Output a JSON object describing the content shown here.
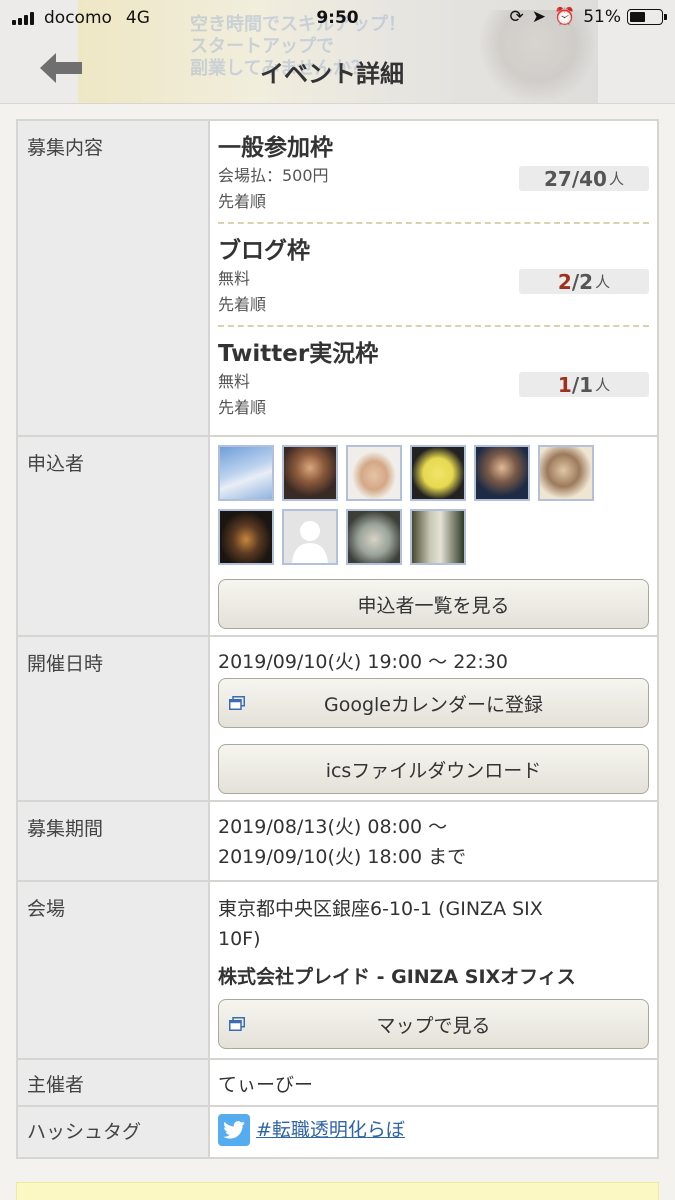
{
  "status_bar": {
    "carrier": "docomo",
    "network": "4G",
    "time": "9:50",
    "battery": "51%",
    "battery_level": 0.51
  },
  "banner": {
    "line1": "空き時間でスキルアップ！",
    "line2": "スタートアップで",
    "line3": "副業してみませんか？"
  },
  "header": {
    "title": "イベント詳細",
    "back_icon": "back-arrow-icon"
  },
  "recruitment": {
    "label": "募集内容",
    "slots": [
      {
        "name": "一般参加枠",
        "fee": "会場払：500円",
        "order": "先着順",
        "current": "27",
        "sep": "/",
        "capacity": "40",
        "unit": "人",
        "full": false
      },
      {
        "name": "ブログ枠",
        "fee": "無料",
        "order": "先着順",
        "current": "2",
        "sep": "/",
        "capacity": "2",
        "unit": "人",
        "full": true
      },
      {
        "name": "Twitter実況枠",
        "fee": "無料",
        "order": "先着順",
        "current": "1",
        "sep": "/",
        "capacity": "1",
        "unit": "人",
        "full": true
      }
    ]
  },
  "applicants": {
    "label": "申込者",
    "avatar_count": 10,
    "button": "申込者一覧を見る"
  },
  "schedule": {
    "label": "開催日時",
    "datetime": "2019/09/10(火) 19:00 〜 22:30",
    "google_button": "Googleカレンダーに登録",
    "ics_button": "icsファイルダウンロード"
  },
  "period": {
    "label": "募集期間",
    "line1": "2019/08/13(火) 08:00 〜",
    "line2": "2019/09/10(火) 18:00 まで"
  },
  "venue": {
    "label": "会場",
    "address_line1": "東京都中央区銀座6-10-1 (GINZA SIX",
    "address_line2": "10F)",
    "name": "株式会社プレイド - GINZA SIXオフィス",
    "map_button": "マップで見る"
  },
  "organizer": {
    "label": "主催者",
    "name": "てぃーびー"
  },
  "hashtag": {
    "label": "ハッシュタグ",
    "tag": "#転職透明化らぼ",
    "icon": "twitter-icon"
  },
  "colors": {
    "full_count": "#a0301d",
    "link": "#2f64a8",
    "twitter": "#55acee",
    "label_bg": "#ebebeb"
  }
}
